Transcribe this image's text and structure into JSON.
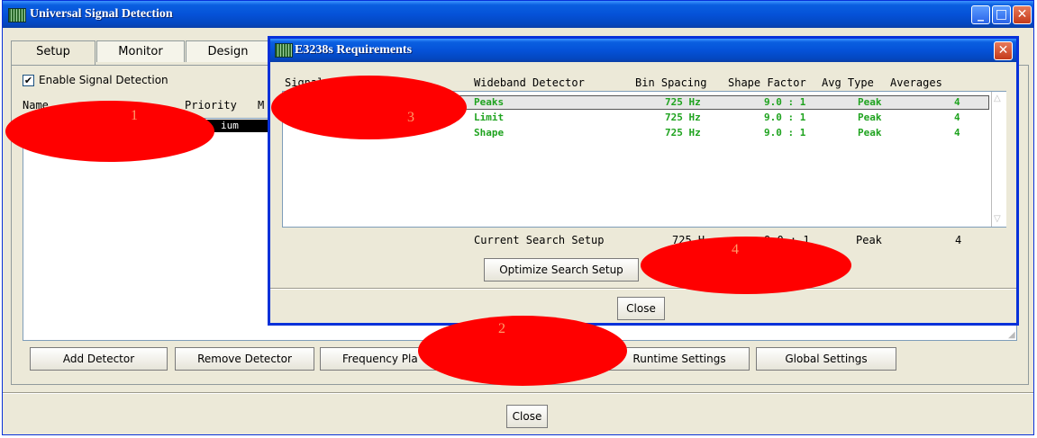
{
  "main_window": {
    "title": "Universal Signal Detection",
    "tabs": [
      {
        "label": "Setup"
      },
      {
        "label": "Monitor"
      },
      {
        "label": "Design"
      }
    ],
    "enable_checkbox": {
      "label": "Enable Signal Detection",
      "checked": true
    },
    "columns": {
      "name": "Name",
      "priority": "Priority",
      "third_partial": "M"
    },
    "selected_row_partial": "ium",
    "buttons": {
      "add_detector": "Add Detector",
      "remove_detector": "Remove Detector",
      "frequency_plan_partial": "Frequency Pla",
      "runtime_settings": "Runtime Settings",
      "global_settings": "Global Settings",
      "close": "Close"
    }
  },
  "dialog": {
    "title": "E3238s Requirements",
    "columns": {
      "signal_detector_partial": "Signal Detecto",
      "wideband_detector": "Wideband Detector",
      "bin_spacing": "Bin Spacing",
      "shape_factor": "Shape Factor",
      "avg_type": "Avg Type",
      "averages": "Averages"
    },
    "rows": [
      {
        "wideband": "Peaks",
        "bin": "725 Hz",
        "shape": "9.0 : 1",
        "avg_type": "Peak",
        "averages": "4"
      },
      {
        "wideband": "Limit",
        "bin": "725 Hz",
        "shape": "9.0 : 1",
        "avg_type": "Peak",
        "averages": "4"
      },
      {
        "wideband": "Shape",
        "bin": "725 Hz",
        "shape": "9.0 : 1",
        "avg_type": "Peak",
        "averages": "4"
      }
    ],
    "current": {
      "label": "Current Search Setup",
      "bin_partial": "725 H",
      "shape_partial": "9.0 : 1",
      "avg_type": "Peak",
      "averages": "4"
    },
    "buttons": {
      "optimize": "Optimize Search Setup",
      "close": "Close"
    }
  },
  "annotations": {
    "a1": "1",
    "a2": "2",
    "a3": "3",
    "a4": "4"
  },
  "colors": {
    "title_blue": "#0552d8",
    "row_green": "#1fa31f",
    "overlay_red": "#ff0000"
  }
}
